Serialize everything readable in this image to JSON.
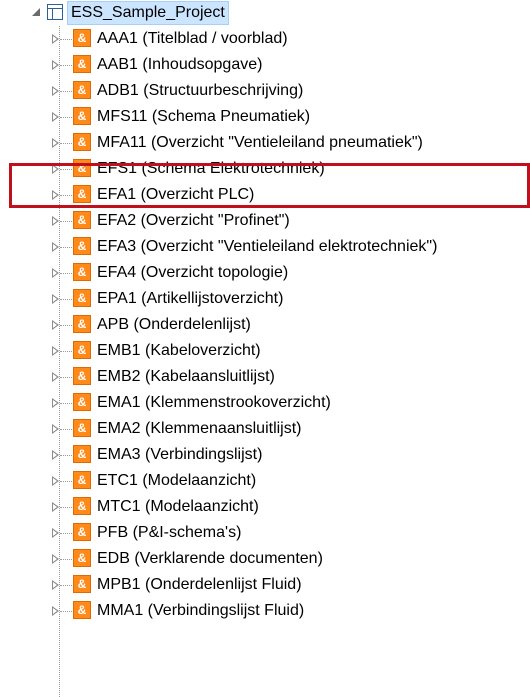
{
  "project": {
    "name": "ESS_Sample_Project",
    "icon": "table-project-icon"
  },
  "node_icon": {
    "name": "ampersand-page-icon",
    "glyph": "&",
    "color": "#ff8a1a"
  },
  "items": [
    {
      "label": "AAA1 (Titelblad / voorblad)"
    },
    {
      "label": "AAB1 (Inhoudsopgave)"
    },
    {
      "label": "ADB1 (Structuurbeschrijving)"
    },
    {
      "label": "MFS11 (Schema Pneumatiek)"
    },
    {
      "label": "MFA11 (Overzicht \"Ventieleiland pneumatiek\")"
    },
    {
      "label": "EFS1 (Schema Elektrotechniek)"
    },
    {
      "label": "EFA1 (Overzicht PLC)"
    },
    {
      "label": "EFA2 (Overzicht \"Profinet\")"
    },
    {
      "label": "EFA3 (Overzicht \"Ventieleiland elektrotechniek\")"
    },
    {
      "label": "EFA4 (Overzicht topologie)"
    },
    {
      "label": "EPA1 (Artikellijstoverzicht)"
    },
    {
      "label": "APB (Onderdelenlijst)"
    },
    {
      "label": "EMB1 (Kabeloverzicht)"
    },
    {
      "label": "EMB2 (Kabelaansluitlijst)"
    },
    {
      "label": "EMA1 (Klemmenstrookoverzicht)"
    },
    {
      "label": "EMA2 (Klemmenaansluitlijst)"
    },
    {
      "label": "EMA3 (Verbindingslijst)"
    },
    {
      "label": "ETC1 (Modelaanzicht)"
    },
    {
      "label": "MTC1 (Modelaanzicht)"
    },
    {
      "label": "PFB (P&I-schema's)"
    },
    {
      "label": "EDB (Verklarende documenten)"
    },
    {
      "label": "MPB1 (Onderdelenlijst Fluid)"
    },
    {
      "label": "MMA1 (Verbindingslijst Fluid)"
    }
  ],
  "highlight": {
    "color": "#c0101e"
  }
}
